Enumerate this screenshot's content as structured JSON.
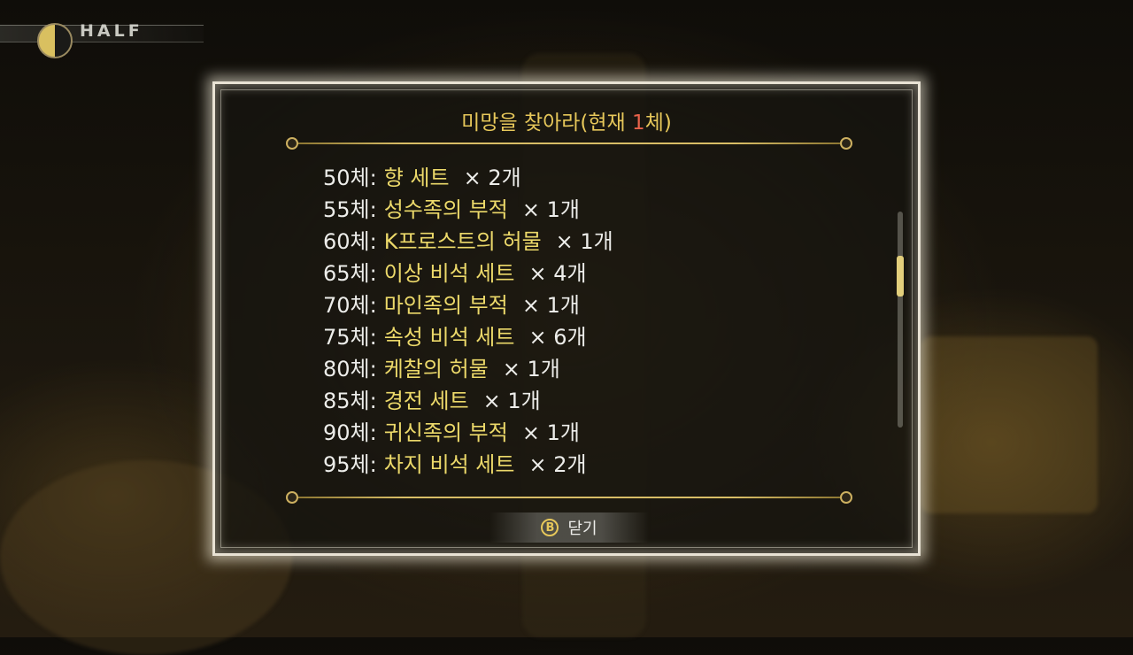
{
  "hud": {
    "mode_label": "HALF",
    "moon_icon": "half-moon-icon"
  },
  "dialog": {
    "title_prefix": "미망을 찾아라(현재 ",
    "current_count": "1",
    "title_suffix": "체)",
    "rewards": [
      {
        "level": "50체:",
        "item": "향 세트",
        "qty": "× 2개"
      },
      {
        "level": "55체:",
        "item": "성수족의 부적",
        "qty": "× 1개"
      },
      {
        "level": "60체:",
        "item": "K프로스트의 허물",
        "qty": "× 1개"
      },
      {
        "level": "65체:",
        "item": "이상 비석 세트",
        "qty": "× 4개"
      },
      {
        "level": "70체:",
        "item": "마인족의 부적",
        "qty": "× 1개"
      },
      {
        "level": "75체:",
        "item": "속성 비석 세트",
        "qty": "× 6개"
      },
      {
        "level": "80체:",
        "item": "케찰의 허물",
        "qty": "× 1개"
      },
      {
        "level": "85체:",
        "item": "경전 세트",
        "qty": "× 1개"
      },
      {
        "level": "90체:",
        "item": "귀신족의 부적",
        "qty": "× 1개"
      },
      {
        "level": "95체:",
        "item": "차지 비석 세트",
        "qty": "× 2개"
      }
    ],
    "scroll_position": 0.25,
    "close_button": {
      "icon": "B",
      "label": "닫기"
    }
  },
  "colors": {
    "title": "#e6c75a",
    "highlight": "#e8624a",
    "item": "#ecd96a",
    "text": "#ededea"
  }
}
